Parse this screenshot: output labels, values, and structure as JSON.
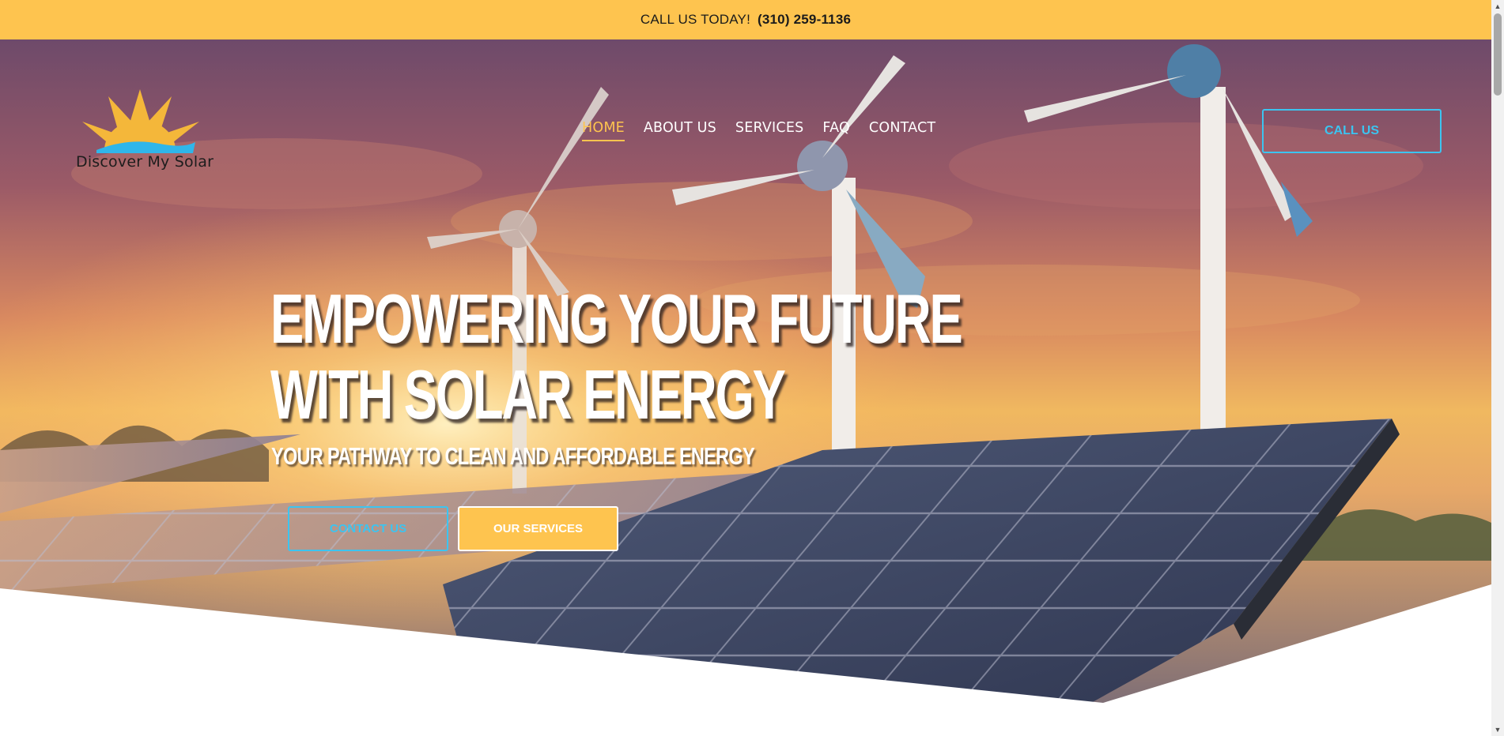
{
  "topbar": {
    "label": "CALL US TODAY!",
    "phone": "(310) 259-1136",
    "background": "#fec44f"
  },
  "logo": {
    "text": "Discover My Solar",
    "icon": "sun-over-wave-icon"
  },
  "nav": {
    "items": [
      {
        "label": "HOME",
        "active": true
      },
      {
        "label": "ABOUT US",
        "active": false
      },
      {
        "label": "SERVICES",
        "active": false
      },
      {
        "label": "FAQ",
        "active": false
      },
      {
        "label": "CONTACT",
        "active": false
      }
    ],
    "active_color": "#fec44f"
  },
  "header_cta": {
    "label": "CALL US",
    "color": "#3cc4f0"
  },
  "hero": {
    "title_line1": "EMPOWERING YOUR FUTURE",
    "title_line2": "WITH SOLAR ENERGY",
    "subtitle": "YOUR PATHWAY TO CLEAN AND AFFORDABLE ENERGY",
    "buttons": {
      "contact": "CONTACT US",
      "services": "OUR SERVICES"
    }
  },
  "colors": {
    "accent_yellow": "#fec44f",
    "accent_blue": "#3cc4f0"
  }
}
